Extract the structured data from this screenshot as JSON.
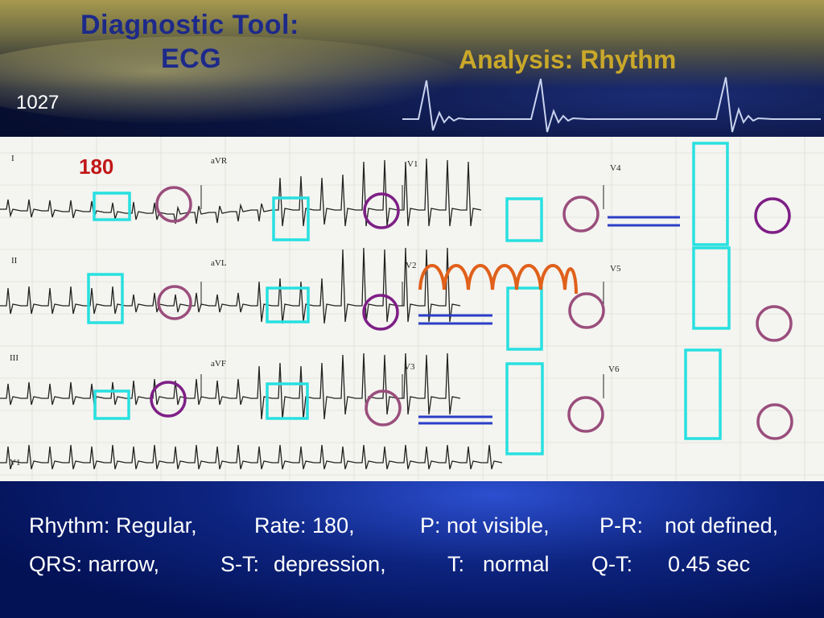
{
  "slide": {
    "title_line1": "Diagnostic Tool:",
    "title_line2": "ECG",
    "subtitle": "Analysis: Rhythm",
    "slide_number": "1027"
  },
  "ecg": {
    "rate_annotation": "180",
    "lead_labels": [
      "I",
      "aVR",
      "V1",
      "V4",
      "II",
      "aVL",
      "V2",
      "V5",
      "III",
      "aVF",
      "V3",
      "V6",
      "V1"
    ],
    "annotation_colors": {
      "qrs_box": "#27e0e0",
      "t_wave_circle": "#8a2f7a",
      "st_line": "#2a3ec8",
      "p_arc": "#e0601a"
    }
  },
  "findings": {
    "rhythm": "Rhythm: Regular,",
    "rate": "Rate: 180,",
    "p_wave": "P: not visible,",
    "pr": "P-R:",
    "pr_value": "not defined,",
    "qrs": "QRS: narrow,",
    "st": "S-T:",
    "st_value": "depression,",
    "t_wave": "T:",
    "t_value": "normal",
    "qt": "Q-T:",
    "qt_value": "0.45 sec"
  }
}
